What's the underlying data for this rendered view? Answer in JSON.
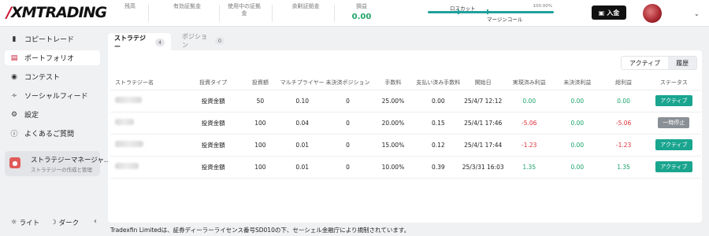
{
  "topbar": {
    "logo_text": "XMTRADING",
    "stats": [
      {
        "label": "残高",
        "value": ""
      },
      {
        "label": "有効証拠金",
        "value": ""
      },
      {
        "label": "使用中の証拠金",
        "value": ""
      },
      {
        "label": "余剰証拠金",
        "value": ""
      },
      {
        "label": "損益",
        "value": "0.00"
      }
    ],
    "margin": {
      "losscut_label": "ロスカット",
      "margin_call_label": "マージンコール",
      "percent": "100.00%",
      "level": 1.0
    },
    "deposit_label": "入金"
  },
  "sidebar": {
    "items": [
      {
        "label": "コピートレード",
        "icon": "bar-chart-icon",
        "active": false
      },
      {
        "label": "ポートフォリオ",
        "icon": "briefcase-icon",
        "active": true
      },
      {
        "label": "コンテスト",
        "icon": "award-icon",
        "active": false
      },
      {
        "label": "ソーシャルフィード",
        "icon": "rss-icon",
        "active": false
      },
      {
        "label": "設定",
        "icon": "gear-icon",
        "active": false
      },
      {
        "label": "よくあるご質問",
        "icon": "help-icon",
        "active": false
      }
    ],
    "strategy_manager": {
      "title": "ストラテジーマネージャ...",
      "subtitle": "ストラテジーの作成と管理"
    },
    "theme_light": "ライト",
    "theme_dark": "ダーク"
  },
  "tabs": [
    {
      "label": "ストラテジー",
      "count": "4",
      "active": true
    },
    {
      "label": "ポジション",
      "count": "0",
      "active": false
    }
  ],
  "filter": {
    "active_label": "アクティブ",
    "history_label": "履歴"
  },
  "table": {
    "headers": [
      "ストラテジー名",
      "投資タイプ",
      "投資額",
      "マルチプライヤー",
      "未決済ポジション",
      "手数料",
      "支払い済み手数料",
      "開始日",
      "実現済み利益",
      "未決済利益",
      "総利益",
      "ステータス"
    ],
    "rows": [
      {
        "type": "投資金額",
        "amount": "50",
        "multiplier": "0.10",
        "open_pos": "0",
        "fee": "25.00%",
        "fee_paid": "0.00",
        "start": "25/4/7 12:12",
        "realized": "0.00",
        "unrealized": "0.00",
        "total": "0.00",
        "status": "アクティブ",
        "status_kind": "active",
        "sign": "pos"
      },
      {
        "type": "投資金額",
        "amount": "100",
        "multiplier": "0.04",
        "open_pos": "0",
        "fee": "20.00%",
        "fee_paid": "0.15",
        "start": "25/4/1 17:46",
        "realized": "-5.06",
        "unrealized": "0.00",
        "total": "-5.06",
        "status": "一時停止",
        "status_kind": "paused",
        "sign": "neg"
      },
      {
        "type": "投資金額",
        "amount": "100",
        "multiplier": "0.01",
        "open_pos": "0",
        "fee": "15.00%",
        "fee_paid": "0.12",
        "start": "25/4/1 17:44",
        "realized": "-1.23",
        "unrealized": "0.00",
        "total": "-1.23",
        "status": "アクティブ",
        "status_kind": "active",
        "sign": "neg"
      },
      {
        "type": "投資金額",
        "amount": "100",
        "multiplier": "0.01",
        "open_pos": "0",
        "fee": "10.00%",
        "fee_paid": "0.39",
        "start": "25/3/31 16:03",
        "realized": "1.35",
        "unrealized": "0.00",
        "total": "1.35",
        "status": "アクティブ",
        "status_kind": "active",
        "sign": "pos"
      }
    ]
  },
  "footer": "Tradexfin Limitedは、証券ディーラーライセンス番号SD010の下、セーシェル金融庁により規制されています。",
  "colors": {
    "brand_red": "#c8102e",
    "positive": "#1aa36a",
    "negative": "#e0303a",
    "status_active": "#1aa58f",
    "status_paused": "#8a8f96"
  }
}
